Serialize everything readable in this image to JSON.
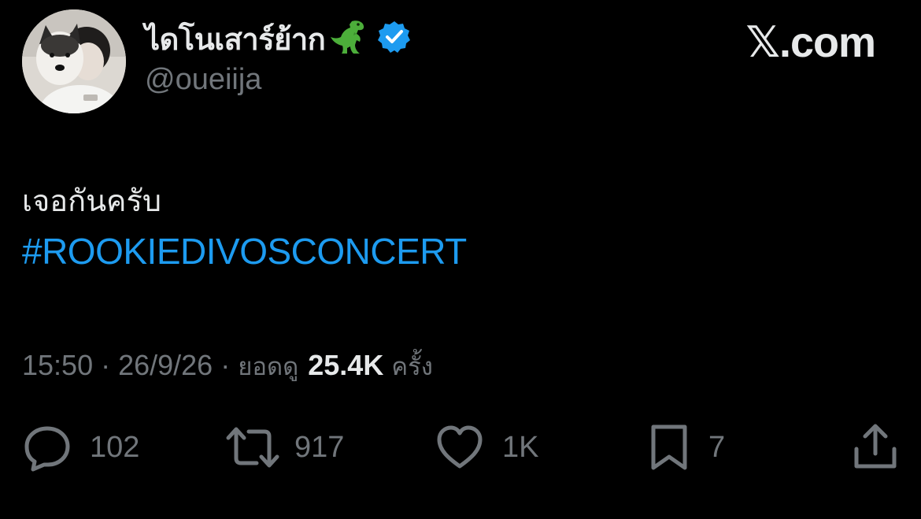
{
  "header": {
    "display_name": "ไดโนเสาร์ย้าก",
    "handle": "@oueiija",
    "site_label": "𝕏.com"
  },
  "tweet": {
    "text": "เจอกันครับ",
    "hashtag": "#ROOKIEDIVOSCONCERT"
  },
  "meta": {
    "time": "15:50",
    "separator": "·",
    "date": "26/9/26",
    "views_label": "ยอดดู",
    "views_count": "25.4K",
    "views_suffix": "ครั้ง"
  },
  "actions": {
    "replies": "102",
    "reposts": "917",
    "likes": "1K",
    "bookmarks": "7"
  },
  "colors": {
    "background": "#000000",
    "primary_text": "#e7e9ea",
    "secondary_text": "#71767b",
    "link": "#1d9bf0",
    "verified": "#1d9bf0"
  },
  "icons": {
    "dino": "t-rex-emoji-icon",
    "verified": "verified-badge-icon",
    "reply": "reply-icon",
    "repost": "repost-icon",
    "like": "heart-icon",
    "bookmark": "bookmark-icon",
    "share": "share-icon"
  }
}
